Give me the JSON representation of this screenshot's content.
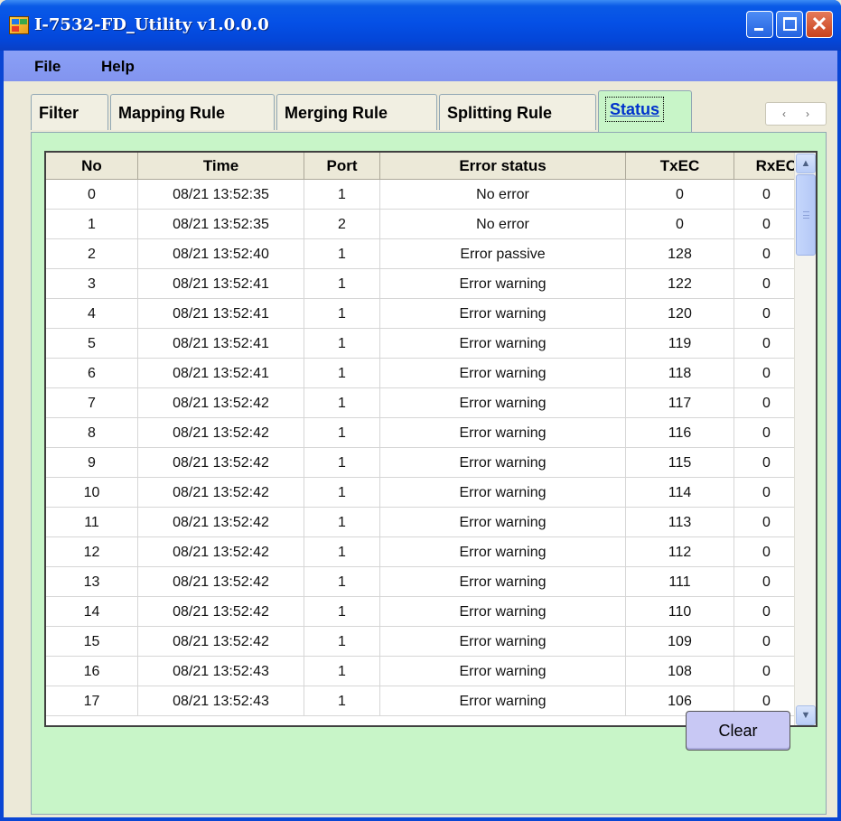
{
  "window": {
    "title": "I-7532-FD_Utility v1.0.0.0",
    "close_glyph": "✕"
  },
  "menu": {
    "file": "File",
    "help": "Help"
  },
  "tabs": [
    {
      "label": "Filter"
    },
    {
      "label": "Mapping Rule"
    },
    {
      "label": "Merging Rule"
    },
    {
      "label": "Splitting Rule"
    },
    {
      "label": "Status",
      "selected": true
    }
  ],
  "tab_scroller": {
    "left": "‹",
    "right": "›"
  },
  "grid": {
    "columns": [
      "No",
      "Time",
      "Port",
      "Error status",
      "TxEC",
      "RxEC"
    ],
    "rows": [
      [
        "0",
        "08/21 13:52:35",
        "1",
        "No error",
        "0",
        "0"
      ],
      [
        "1",
        "08/21 13:52:35",
        "2",
        "No error",
        "0",
        "0"
      ],
      [
        "2",
        "08/21 13:52:40",
        "1",
        "Error passive",
        "128",
        "0"
      ],
      [
        "3",
        "08/21 13:52:41",
        "1",
        "Error warning",
        "122",
        "0"
      ],
      [
        "4",
        "08/21 13:52:41",
        "1",
        "Error warning",
        "120",
        "0"
      ],
      [
        "5",
        "08/21 13:52:41",
        "1",
        "Error warning",
        "119",
        "0"
      ],
      [
        "6",
        "08/21 13:52:41",
        "1",
        "Error warning",
        "118",
        "0"
      ],
      [
        "7",
        "08/21 13:52:42",
        "1",
        "Error warning",
        "117",
        "0"
      ],
      [
        "8",
        "08/21 13:52:42",
        "1",
        "Error warning",
        "116",
        "0"
      ],
      [
        "9",
        "08/21 13:52:42",
        "1",
        "Error warning",
        "115",
        "0"
      ],
      [
        "10",
        "08/21 13:52:42",
        "1",
        "Error warning",
        "114",
        "0"
      ],
      [
        "11",
        "08/21 13:52:42",
        "1",
        "Error warning",
        "113",
        "0"
      ],
      [
        "12",
        "08/21 13:52:42",
        "1",
        "Error warning",
        "112",
        "0"
      ],
      [
        "13",
        "08/21 13:52:42",
        "1",
        "Error warning",
        "111",
        "0"
      ],
      [
        "14",
        "08/21 13:52:42",
        "1",
        "Error warning",
        "110",
        "0"
      ],
      [
        "15",
        "08/21 13:52:42",
        "1",
        "Error warning",
        "109",
        "0"
      ],
      [
        "16",
        "08/21 13:52:43",
        "1",
        "Error warning",
        "108",
        "0"
      ],
      [
        "17",
        "08/21 13:52:43",
        "1",
        "Error warning",
        "106",
        "0"
      ]
    ]
  },
  "scrollbar": {
    "up": "▲",
    "down": "▼"
  },
  "buttons": {
    "clear": "Clear"
  },
  "colors": {
    "tab_page_bg": "#c8f5c8",
    "clear_button_bg": "#c8c8f4",
    "titlebar": "#0550e6",
    "menubar": "#8a9cf3"
  }
}
